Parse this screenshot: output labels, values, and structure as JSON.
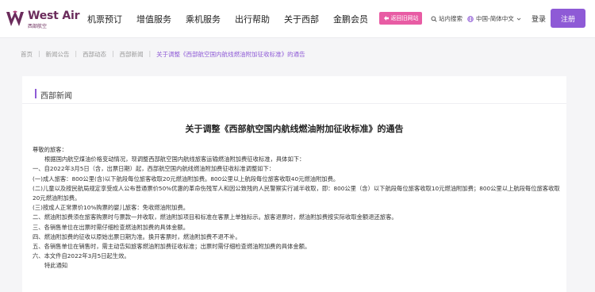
{
  "header": {
    "brand_name": "West Air",
    "brand_sub": "西部航空",
    "nav": [
      "机票预订",
      "增值服务",
      "乘机服务",
      "出行帮助",
      "关于西部",
      "金鹏会员"
    ],
    "old_site_label": "返回旧网站",
    "site_search_label": "站内搜索",
    "language_label": "中国-简体中文",
    "login_label": "登录",
    "register_label": "注册"
  },
  "breadcrumb": [
    "首页",
    "新闻公告",
    "西部动态",
    "西部新闻",
    "关于调整《西部航空国内航线燃油附加征收标准》的通告"
  ],
  "panel": {
    "heading": "西部新闻"
  },
  "article": {
    "title": "关于调整《西部航空国内航线燃油附加征收标准》的通告",
    "paragraphs": [
      "尊敬的旅客：",
      "根据国内航空煤油价格变动情况，现调整西部航空国内航线旅客运输燃油附加费征收标准，具体如下：",
      "一、自2022年3月5日（含，出票日期）起，西部航空国内航线燃油附加费征收标准调整如下：",
      "(一)成人旅客：800公里(含)以下航段每位旅客收取20元燃油附加费。800公里以上航段每位旅客收取40元燃油附加费。",
      "(二)儿童以及按民航局规定享受成人公布普通票价50%优惠的革命伤残军人和因公致残的人民警察实行减半收取，即：800公里（含）以下航段每位旅客收取10元燃油附加费；800公里以上航段每位旅客收取20元燃油附加费。",
      "(三)按成人正常票价10%购票的婴儿旅客：免收燃油附加费。",
      "二、燃油附加费须在旅客购票时与票款一并收取，燃油附加项目和标准在客票上单独标示。旅客退票时，燃油附加费按实际收取金额退还旅客。",
      "三、各销售单位在出票时需仔细检查燃油附加费的具体金额。",
      "四、燃油附加费的征收以原始出票日期为准。换开客票时，燃油附加费不退不补。",
      "五、各销售单位在销售时，需主动告知旅客燃油附加费征收标准；出票时需仔细检查燃油附加费的具体金额。",
      "六、本文件自2022年3月5日起生效。",
      "特此通知"
    ]
  },
  "colors": {
    "brand": "#6b2c5c",
    "accent": "#8e5ad6",
    "old_site_button": "#e85ca4"
  }
}
